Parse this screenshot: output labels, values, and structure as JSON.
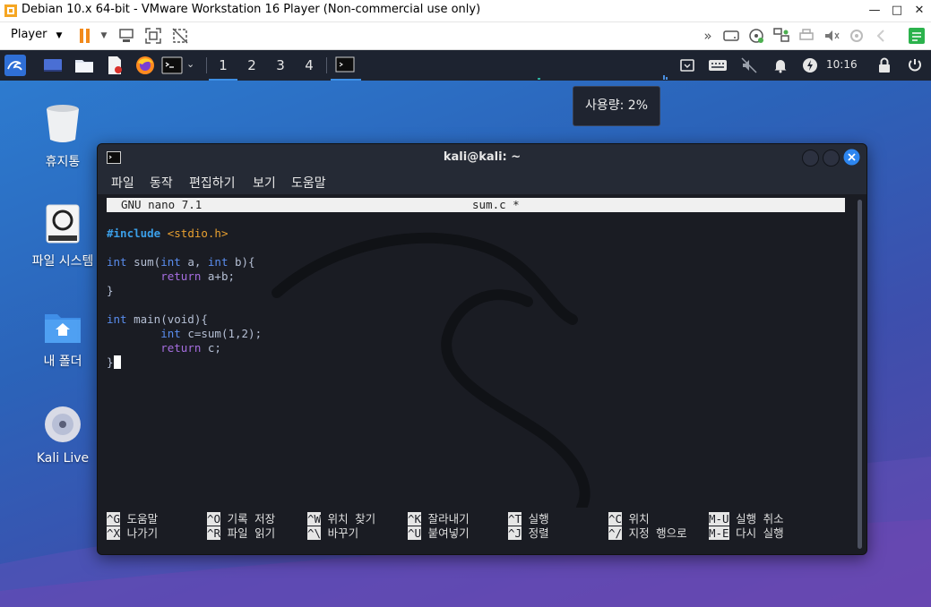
{
  "vm": {
    "title": "Debian 10.x 64-bit - VMware Workstation 16 Player (Non-commercial use only)",
    "player_label": "Player",
    "window_controls": [
      "minimize",
      "maximize",
      "close"
    ]
  },
  "kali_panel": {
    "workspaces": [
      "1",
      "2",
      "3",
      "4"
    ],
    "active_workspace": "1",
    "clock": "10:16"
  },
  "desktop": {
    "items": [
      {
        "label": "휴지통",
        "icon": "trash-icon"
      },
      {
        "label": "파일 시스템",
        "icon": "drive-icon"
      },
      {
        "label": "내 폴더",
        "icon": "home-folder-icon"
      },
      {
        "label": "Kali Live",
        "icon": "disc-icon"
      }
    ],
    "tooltip": "사용량: 2%"
  },
  "terminal": {
    "title": "kali@kali: ~",
    "menu": [
      "파일",
      "동작",
      "편집하기",
      "보기",
      "도움말"
    ],
    "nano_version": "GNU nano 7.1",
    "filename": "sum.c *",
    "code": {
      "include_directive": "#include",
      "include_file": "<stdio.h>",
      "line_sum_sig_a": "int",
      "line_sum_sig_b": " sum(",
      "line_sum_sig_c": "int",
      "line_sum_sig_d": " a, ",
      "line_sum_sig_e": "int",
      "line_sum_sig_f": " b){",
      "line_return_kw": "return",
      "line_return_expr": " a+b;",
      "close_brace": "}",
      "line_main_kw": "int",
      "line_main_rest": " main(void){",
      "line_c_kw": "int",
      "line_c_rest": " c=sum(1,2);",
      "line_ret2_kw": "return",
      "line_ret2_rest": " c;",
      "final_brace": "}"
    },
    "shortcuts": [
      [
        {
          "key": "^G",
          "label": "도움말"
        },
        {
          "key": "^O",
          "label": "기록 저장"
        },
        {
          "key": "^W",
          "label": "위치 찾기"
        },
        {
          "key": "^K",
          "label": "잘라내기"
        },
        {
          "key": "^T",
          "label": "실행"
        },
        {
          "key": "^C",
          "label": "위치"
        },
        {
          "key": "M-U",
          "label": "실행 취소"
        }
      ],
      [
        {
          "key": "^X",
          "label": "나가기"
        },
        {
          "key": "^R",
          "label": "파일 읽기"
        },
        {
          "key": "^\\",
          "label": "바꾸기"
        },
        {
          "key": "^U",
          "label": "붙여넣기"
        },
        {
          "key": "^J",
          "label": "정렬"
        },
        {
          "key": "^/",
          "label": "지정 행으로"
        },
        {
          "key": "M-E",
          "label": "다시 실행"
        }
      ]
    ]
  }
}
